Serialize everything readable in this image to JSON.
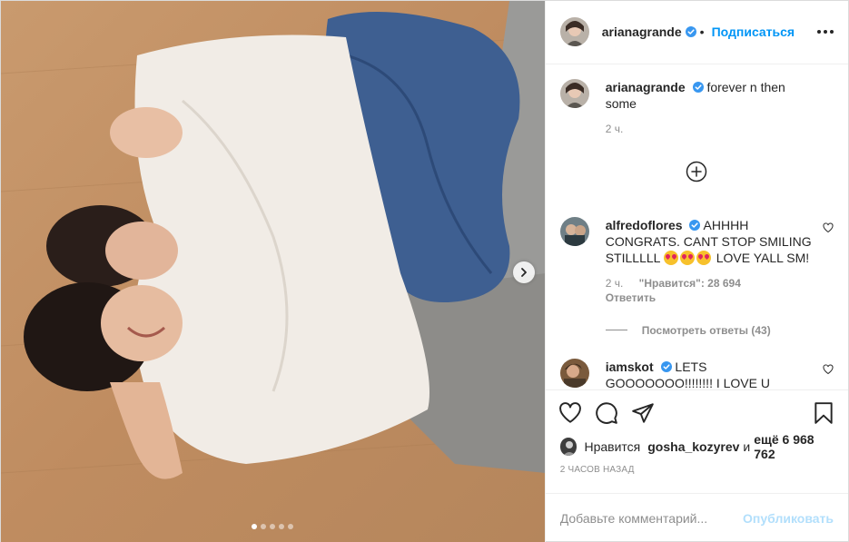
{
  "post": {
    "author": "arianagrande",
    "follow_label": "Подписаться",
    "dot_separator": "•",
    "caption": "forever n then some",
    "caption_time": "2 ч.",
    "carousel": {
      "total": 5,
      "active_index": 0
    }
  },
  "comments": [
    {
      "username": "alfredoflores",
      "text_before": "AHHHH CONGRATS. CANT STOP SMILING STILLLLL",
      "text_after": "LOVE YALL SM!",
      "emoji_count": 3,
      "time": "2 ч.",
      "likes_label": "\"Нравится\": 28 694",
      "reply_label": "Ответить",
      "view_replies_label": "Посмотреть ответы (43)"
    },
    {
      "username": "iamskot",
      "text": "LETS GOOOOOOO!!!!!!!! I LOVE U BOTH!!"
    }
  ],
  "likes": {
    "prefix": "Нравится",
    "user": "gosha_kozyrev",
    "and": "и",
    "others": "ещё 6 968 762"
  },
  "timestamp": "2 часов назад",
  "add_comment": {
    "placeholder": "Добавьте комментарий...",
    "publish_label": "Опубликовать"
  },
  "icons": {
    "verified": "verified-badge-icon",
    "more": "more-options-icon",
    "plus": "plus-circle-icon",
    "heart": "heart-icon",
    "comment": "comment-icon",
    "share": "share-icon",
    "save": "bookmark-icon",
    "next": "chevron-right-icon"
  },
  "colors": {
    "accent": "#0095f6",
    "muted": "#8e8e8e",
    "text": "#262626",
    "publish_disabled": "#b2dffc"
  }
}
